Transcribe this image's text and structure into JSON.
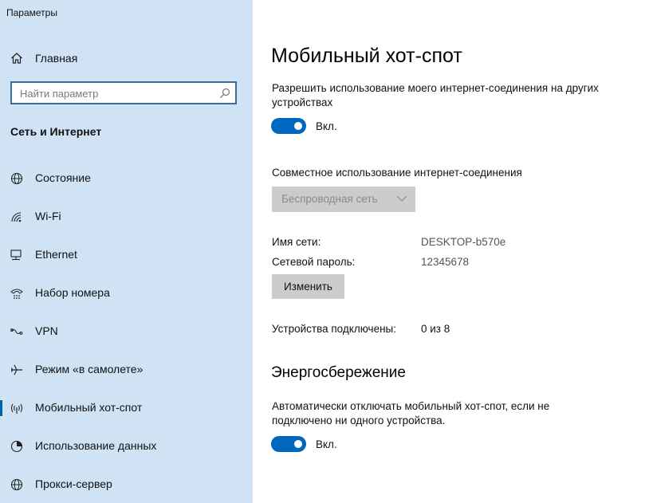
{
  "window": {
    "title": "Параметры"
  },
  "sidebar": {
    "home_label": "Главная",
    "search_placeholder": "Найти параметр",
    "section_title": "Сеть и Интернет",
    "items": [
      {
        "label": "Состояние",
        "icon": "globe-icon"
      },
      {
        "label": "Wi-Fi",
        "icon": "wifi-icon"
      },
      {
        "label": "Ethernet",
        "icon": "ethernet-icon"
      },
      {
        "label": "Набор номера",
        "icon": "dialup-icon"
      },
      {
        "label": "VPN",
        "icon": "vpn-icon"
      },
      {
        "label": "Режим «в самолете»",
        "icon": "airplane-icon"
      },
      {
        "label": "Мобильный хот-спот",
        "icon": "hotspot-icon",
        "active": true
      },
      {
        "label": "Использование данных",
        "icon": "data-usage-icon"
      },
      {
        "label": "Прокси-сервер",
        "icon": "globe-icon"
      }
    ]
  },
  "main": {
    "title": "Мобильный хот-спот",
    "share_desc_line1": "Разрешить использование моего интернет-соединения на других",
    "share_desc_line2": "устройствах",
    "share_toggle": {
      "on": true,
      "label": "Вкл."
    },
    "sharing_label": "Совместное использование интернет-соединения",
    "sharing_dropdown": "Беспроводная сеть",
    "network_name_label": "Имя сети:",
    "network_name_value": "DESKTOP-b570e",
    "password_label": "Сетевой пароль:",
    "password_value": "12345678",
    "edit_button": "Изменить",
    "devices_label": "Устройства подключены:",
    "devices_value": "0 из 8",
    "power_title": "Энергосбережение",
    "power_desc_line1": "Автоматически отключать мобильный хот-спот, если не",
    "power_desc_line2": "подключено ни одного устройства.",
    "power_toggle": {
      "on": true,
      "label": "Вкл."
    }
  },
  "colors": {
    "sidebar_bg": "#cfe3f5",
    "accent": "#0067c0",
    "button_bg": "#cccccc"
  }
}
